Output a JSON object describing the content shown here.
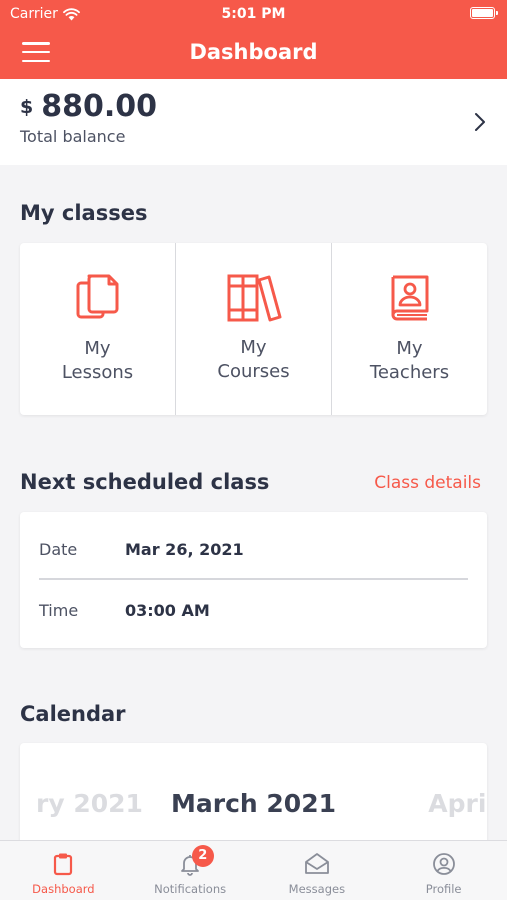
{
  "status_bar": {
    "carrier": "Carrier",
    "time": "5:01 PM"
  },
  "header": {
    "title": "Dashboard",
    "color": "#f6594a"
  },
  "balance": {
    "currency": "$",
    "amount": "880.00",
    "label": "Total balance"
  },
  "my_classes": {
    "title": "My classes",
    "tiles": [
      {
        "line1": "My",
        "line2": "Lessons",
        "icon": "lessons-icon"
      },
      {
        "line1": "My",
        "line2": "Courses",
        "icon": "courses-icon"
      },
      {
        "line1": "My",
        "line2": "Teachers",
        "icon": "teachers-icon"
      }
    ]
  },
  "next_class": {
    "title": "Next scheduled class",
    "link": "Class details",
    "date_label": "Date",
    "date_value": "Mar 26, 2021",
    "time_label": "Time",
    "time_value": "03:00 AM"
  },
  "calendar": {
    "title": "Calendar",
    "prev_month": "ry 2021",
    "current_month": "March 2021",
    "next_month": "April"
  },
  "tabbar": {
    "tabs": [
      {
        "label": "Dashboard",
        "icon": "clipboard-icon",
        "active": true
      },
      {
        "label": "Notifications",
        "icon": "bell-icon",
        "badge": "2"
      },
      {
        "label": "Messages",
        "icon": "envelope-open-icon"
      },
      {
        "label": "Profile",
        "icon": "user-circle-icon"
      }
    ]
  }
}
